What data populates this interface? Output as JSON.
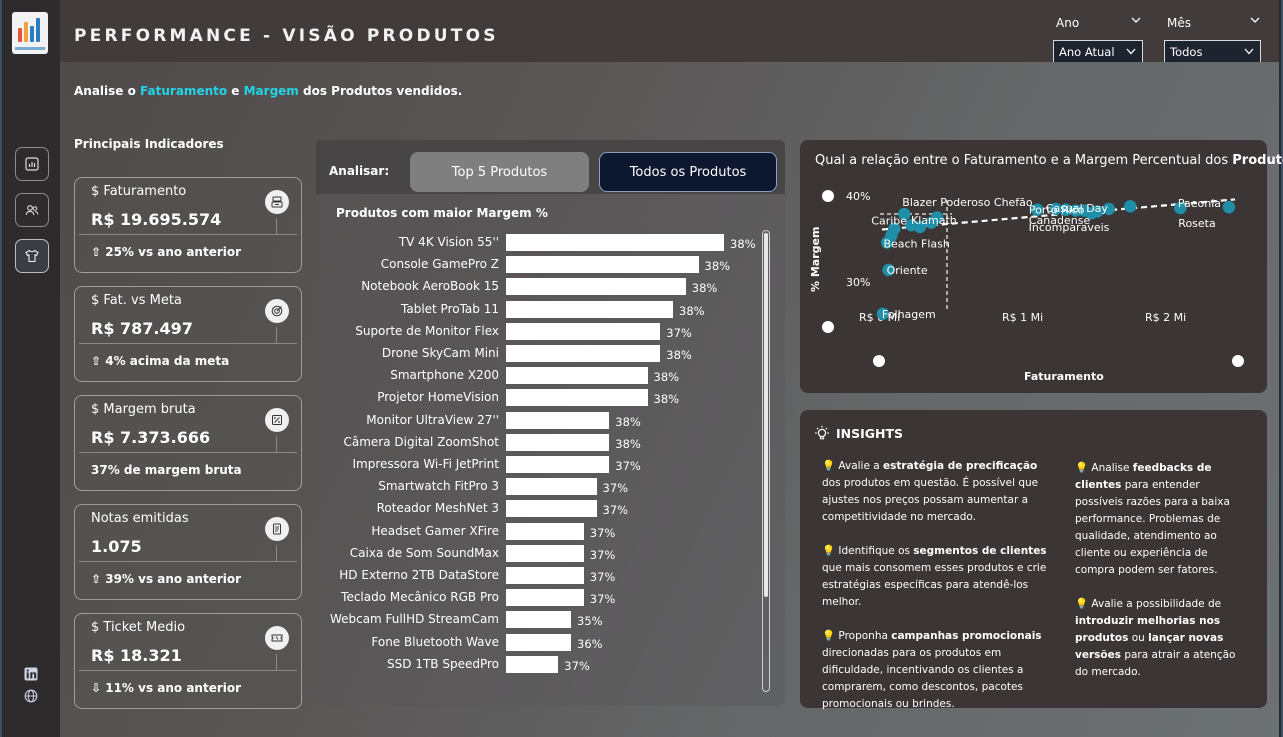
{
  "header": {
    "title": "PERFORMANCE - VISÃO PRODUTOS",
    "filters": [
      {
        "label": "Ano",
        "value": "Ano Atual"
      },
      {
        "label": "Mês",
        "value": "Todos"
      }
    ]
  },
  "subtitle": {
    "prefix": "Analise o ",
    "term1": "Faturamento",
    "middle": " e ",
    "term2": "Margem",
    "suffix": " dos Produtos vendidos."
  },
  "kpis": {
    "heading_prefix": "Principais ",
    "heading_bold": "Indicadores",
    "cards": [
      {
        "title": "$ Faturamento",
        "value": "R$ 19.695.574",
        "foot": "⇧ 25% vs ano anterior",
        "icon": "cash-register-icon"
      },
      {
        "title": "$ Fat. vs Meta",
        "value": "R$ 787.497",
        "foot": "⇧ 4% acima da meta",
        "icon": "target-icon"
      },
      {
        "title": "$ Margem bruta",
        "value": "R$ 7.373.666",
        "foot": "37% de margem bruta",
        "icon": "percent-box-icon"
      },
      {
        "title": "Notas emitidas",
        "value": "1.075",
        "foot": "⇧ 39% vs ano anterior",
        "icon": "receipt-icon"
      },
      {
        "title": "$ Ticket Medio",
        "value": "R$ 18.321",
        "foot": "⇩ 11% vs ano anterior",
        "icon": "ticket-icon"
      }
    ]
  },
  "analyze": {
    "label": "Analisar:",
    "tabs": [
      "Top 5 Produtos",
      "Todos os Produtos"
    ]
  },
  "chart_data": [
    {
      "type": "bar",
      "title": "Produtos com maior Margem %",
      "categories": [
        "TV 4K Vision 55''",
        "Console GamePro Z",
        "Notebook AeroBook 15",
        "Tablet ProTab 11",
        "Suporte de Monitor Flex",
        "Drone SkyCam Mini",
        "Smartphone X200",
        "Projetor HomeVision",
        "Monitor UltraView 27''",
        "Câmera Digital ZoomShot",
        "Impressora Wi-Fi JetPrint",
        "Smartwatch FitPro 3",
        "Roteador MeshNet 3",
        "Headset Gamer XFire",
        "Caixa de Som SoundMax",
        "HD Externo 2TB DataStore",
        "Teclado Mecânico RGB Pro",
        "Webcam FullHD StreamCam",
        "Fone Bluetooth Wave",
        "SSD 1TB SpeedPro"
      ],
      "values": [
        38.4,
        38.2,
        38.1,
        38.0,
        37.9,
        37.9,
        37.8,
        37.8,
        37.5,
        37.5,
        37.5,
        37.4,
        37.4,
        37.3,
        37.3,
        37.3,
        37.3,
        37.2,
        37.2,
        37.1
      ],
      "data_labels": [
        "38%",
        "38%",
        "38%",
        "38%",
        "37%",
        "38%",
        "38%",
        "38%",
        "38%",
        "38%",
        "37%",
        "37%",
        "37%",
        "37%",
        "37%",
        "37%",
        "37%",
        "35%",
        "36%",
        "37%"
      ],
      "orientation": "horizontal"
    },
    {
      "type": "scatter",
      "title_prefix": "Qual a relação entre o Faturamento e a Margem Percentual dos ",
      "title_bold": "Produtos",
      "title_suffix": "?",
      "xlabel": "Faturamento",
      "ylabel": "% Margem",
      "x_ticks": [
        "R$ 0 Mi",
        "R$ 1 Mi",
        "R$ 2 Mi"
      ],
      "y_ticks": [
        "40%",
        "30%"
      ],
      "xlim": [
        -0.12,
        2.5
      ],
      "ylim": [
        24,
        42
      ],
      "trendline": true,
      "points": [
        {
          "name": "Blazer Poderoso Chefão",
          "x": 0.17,
          "y": 37.9
        },
        {
          "name": "Caribe",
          "x": 0.1,
          "y": 36.2
        },
        {
          "name": "Klamath",
          "x": 0.28,
          "y": 36.4
        },
        {
          "name": "Beach Flash",
          "x": 0.08,
          "y": 35.4
        },
        {
          "name": "Oriente",
          "x": 0.06,
          "y": 31.4
        },
        {
          "name": "Folhagem",
          "x": 0.02,
          "y": 26.3
        },
        {
          "name": "Porto Rico",
          "x": 1.37,
          "y": 38.3
        },
        {
          "name": "Casual Day",
          "x": 1.6,
          "y": 38.5
        },
        {
          "name": "Canadense",
          "x": 1.23,
          "y": 38.5
        },
        {
          "name": "Incomparaveis",
          "x": 1.48,
          "y": 38.0
        },
        {
          "name": "Paeonia",
          "x": 2.44,
          "y": 38.7
        },
        {
          "name": "Roseta",
          "x": 2.1,
          "y": 38.6
        },
        {
          "name": "",
          "x": 0.05,
          "y": 34.6
        },
        {
          "name": "",
          "x": 0.22,
          "y": 36.6
        },
        {
          "name": "",
          "x": 0.36,
          "y": 36.9
        },
        {
          "name": "",
          "x": 0.4,
          "y": 37.5
        },
        {
          "name": "",
          "x": 1.1,
          "y": 38.4
        },
        {
          "name": "",
          "x": 1.3,
          "y": 38.4
        },
        {
          "name": "",
          "x": 1.43,
          "y": 38.3
        },
        {
          "name": "",
          "x": 1.52,
          "y": 38.2
        },
        {
          "name": "",
          "x": 1.75,
          "y": 38.8
        }
      ]
    }
  ],
  "insights": {
    "title": "INSIGHTS",
    "col1": [
      {
        "parts": [
          [
            "Avalie a ",
            false
          ],
          [
            "estratégia de precificação",
            true
          ],
          [
            " dos produtos em questão. É possível que ajustes nos preços possam aumentar a competitividade no mercado.",
            false
          ]
        ]
      },
      {
        "parts": [
          [
            "Identifique os ",
            false
          ],
          [
            "segmentos de clientes",
            true
          ],
          [
            " que mais consomem esses produtos e crie estratégias específicas para atendê-los melhor.",
            false
          ]
        ]
      },
      {
        "parts": [
          [
            "Proponha ",
            false
          ],
          [
            "campanhas promocionais",
            true
          ],
          [
            " direcionadas para os produtos em dificuldade, incentivando os clientes a comprarem, como descontos, pacotes promocionais ou brindes.",
            false
          ]
        ]
      }
    ],
    "col2": [
      {
        "parts": [
          [
            "Analise ",
            false
          ],
          [
            "feedbacks de clientes",
            true
          ],
          [
            " para entender possíveis razões para a baixa performance. Problemas de qualidade, atendimento ao cliente ou experiência de compra podem ser fatores.",
            false
          ]
        ]
      },
      {
        "parts": [
          [
            "Avalie a possibilidade de ",
            false
          ],
          [
            "introduzir melhorias nos produtos",
            true
          ],
          [
            " ou ",
            false
          ],
          [
            "lançar novas versões",
            true
          ],
          [
            " para atrair a atenção do mercado.",
            false
          ]
        ]
      }
    ]
  },
  "colors": {
    "accent": "#22d4e8",
    "scatter_point": "#1f8fa8",
    "bar": "#ffffff"
  }
}
